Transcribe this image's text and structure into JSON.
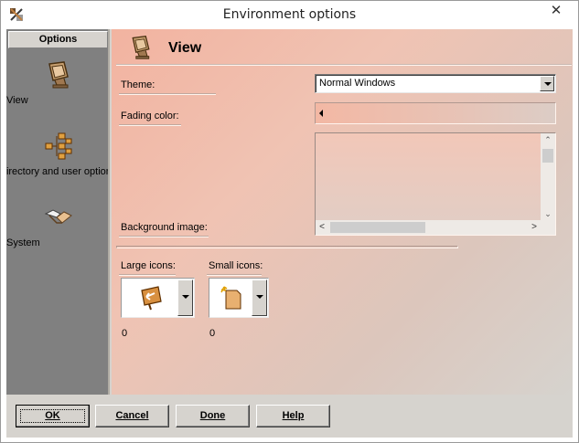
{
  "window": {
    "title": "Environment options",
    "close_glyph": "✕",
    "app_icon": "tools-icon"
  },
  "sidebar": {
    "header": "Options",
    "items": [
      {
        "label": "View",
        "icon": "monitor-icon"
      },
      {
        "label": "Directory and user options",
        "icon": "org-chart-icon"
      },
      {
        "label": "System",
        "icon": "handshake-icon"
      }
    ]
  },
  "panel": {
    "title": "View",
    "theme_label": "Theme:",
    "theme_value": "Normal Windows",
    "fading_color_label": "Fading color:",
    "background_image_label": "Background image:",
    "large_icons_label": "Large icons:",
    "small_icons_label": "Small icons:",
    "large_icons_value": "0",
    "small_icons_value": "0"
  },
  "scroll": {
    "up": "⌃",
    "down": "⌄",
    "left": "<",
    "right": ">"
  },
  "buttons": {
    "ok": "OK",
    "cancel": "Cancel",
    "done": "Done",
    "help": "Help"
  }
}
